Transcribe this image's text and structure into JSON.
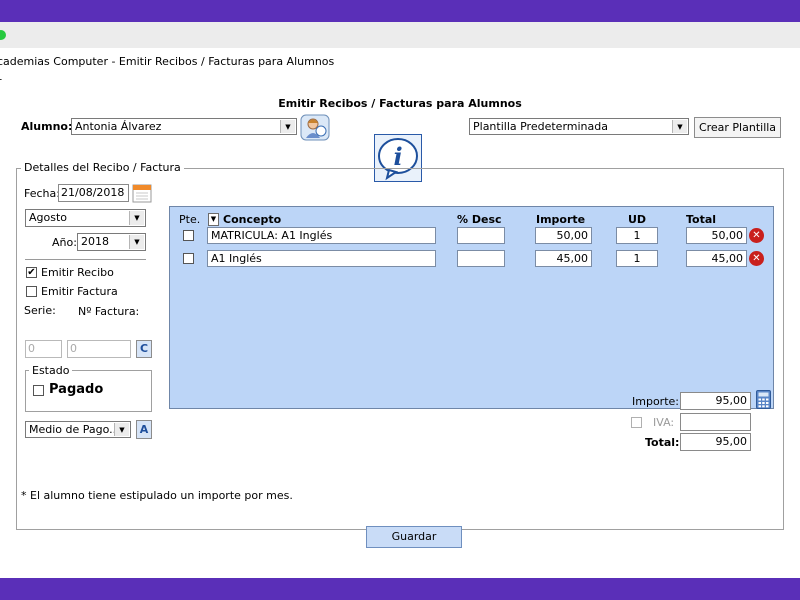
{
  "window": {
    "title": "cademias Computer - Emitir Recibos / Facturas para Alumnos",
    "menu_fragment": "r"
  },
  "form": {
    "heading": "Emitir Recibos / Facturas para Alumnos",
    "alumno_label": "Alumno:",
    "alumno_value": "Antonia Álvarez",
    "plantilla_value": "Plantilla Predeterminada",
    "crear_plantilla_label": "Crear Plantilla"
  },
  "details": {
    "legend": "Detalles del Recibo / Factura",
    "fecha_label": "Fecha:",
    "fecha_value": "21/08/2018",
    "mes_value": "Agosto",
    "anio_label": "Año:",
    "anio_value": "2018",
    "emitir_recibo_label": "Emitir Recibo",
    "emitir_recibo_checked": true,
    "emitir_factura_label": "Emitir Factura",
    "emitir_factura_checked": false,
    "serie_label": "Serie:",
    "serie_value": "0",
    "nfactura_label": "Nº Factura:",
    "nfactura_value": "0",
    "c_button": "C",
    "estado_legend": "Estado",
    "pagado_label": "Pagado",
    "medio_pago_value": "Medio de Pago...",
    "a_button": "A"
  },
  "grid": {
    "headers": {
      "pte": "Pte.",
      "concepto": "Concepto",
      "desc": "% Desc",
      "importe": "Importe",
      "ud": "UD",
      "total": "Total"
    },
    "rows": [
      {
        "concepto": "MATRICULA: A1 Inglés",
        "desc": "",
        "importe": "50,00",
        "ud": "1",
        "total": "50,00"
      },
      {
        "concepto": "A1 Inglés",
        "desc": "",
        "importe": "45,00",
        "ud": "1",
        "total": "45,00"
      }
    ]
  },
  "totals": {
    "importe_label": "Importe:",
    "importe_value": "95,00",
    "iva_label": "IVA:",
    "iva_value": "",
    "total_label": "Total:",
    "total_value": "95,00"
  },
  "footnote": "* El alumno tiene estipulado un importe por mes.",
  "guardar_label": "Guardar",
  "icons": {
    "info": "info-icon",
    "student": "student-icon",
    "calendar": "calendar-icon",
    "calculator": "calculator-icon",
    "delete": "delete-icon"
  },
  "colors": {
    "frame": "#5a2fb8",
    "grid_bg": "#bcd5f7",
    "save_button": "#c9dcf7",
    "delete": "#c9201d"
  }
}
